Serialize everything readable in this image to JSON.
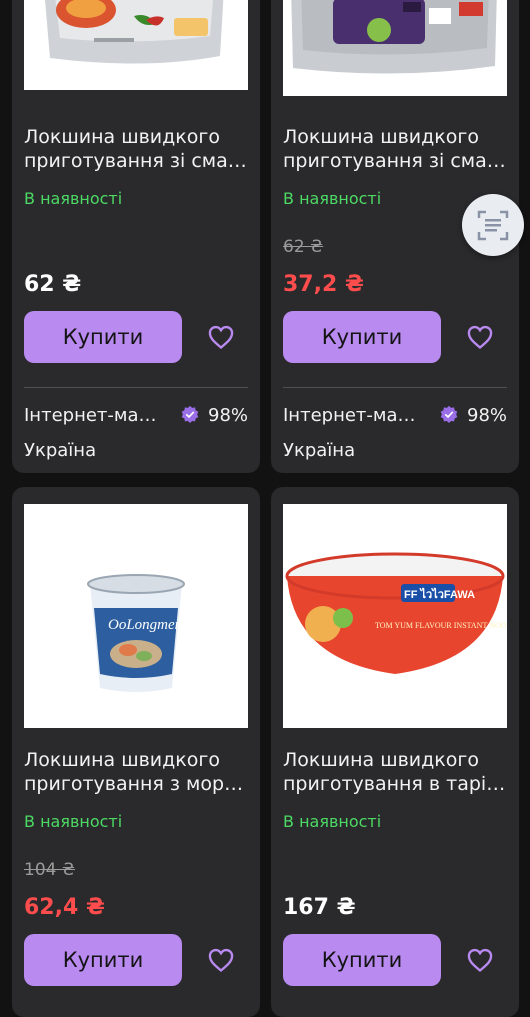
{
  "currency": "₴",
  "colors": {
    "accent": "#b98af0",
    "in_stock": "#4cd964",
    "sale_price": "#ff4d4d",
    "card_bg": "#2a2a2c",
    "page_bg": "#121212"
  },
  "products": [
    {
      "title_line1": "Локшина швидкого",
      "title_line2": "приготування зі сма…",
      "availability": "В наявності",
      "price": "62 ₴",
      "buy_label": "Купити",
      "seller": "Інтернет-ма…",
      "rating": "98%",
      "country": "Україна",
      "image": "instant-noodle-pack-photo"
    },
    {
      "title_line1": "Локшина швидкого",
      "title_line2": "приготування зі сма…",
      "availability": "В наявності",
      "old_price": "62 ₴",
      "price": "37,2 ₴",
      "buy_label": "Купити",
      "seller": "Інтернет-ма…",
      "rating": "98%",
      "country": "Україна",
      "image": "instant-noodle-pack-photo"
    },
    {
      "title_line1": "Локшина швидкого",
      "title_line2": "приготування з мор…",
      "availability": "В наявності",
      "old_price": "104 ₴",
      "price": "62,4 ₴",
      "buy_label": "Купити",
      "image": "noodle-cup-photo",
      "image_text": "OoLongmen"
    },
    {
      "title_line1": "Локшина швидкого",
      "title_line2": "приготування в тарі…",
      "availability": "В наявності",
      "price": "167 ₴",
      "buy_label": "Купити",
      "image": "noodle-bowl-photo",
      "image_text": "FF ไวไวFAWA",
      "image_subtext": "TOM YUM FLAVOUR INSTANT NOODLES"
    }
  ],
  "icons": {
    "favorite": "heart-outline-icon",
    "seller_badge": "verified-badge-icon",
    "scan": "scan-icon"
  }
}
